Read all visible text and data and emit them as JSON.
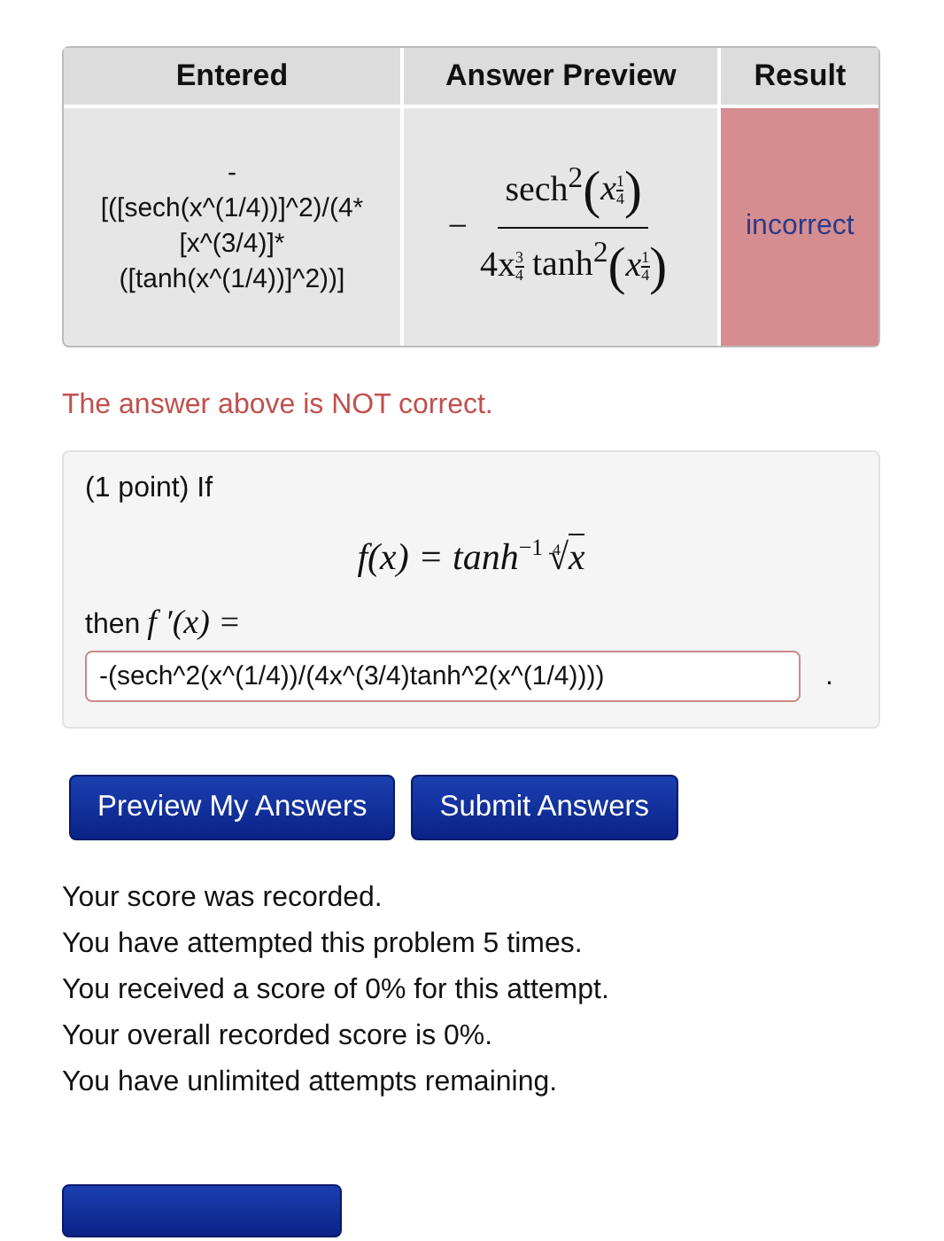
{
  "results_table": {
    "columns": [
      "Entered",
      "Answer Preview",
      "Result"
    ],
    "rows": [
      {
        "entered": "-\n[([sech(x^(1/4))]^2)/(4*\n[x^(3/4)]*\n([tanh(x^(1/4))]^2))]",
        "preview": {
          "sign": "−",
          "numerator": {
            "func": "sech",
            "power": "2",
            "open": "(",
            "base": "x",
            "exp_num": "1",
            "exp_den": "4",
            "close": ")"
          },
          "denominator": {
            "coef": "4x",
            "exp_num": "3",
            "exp_den": "4",
            "func": "tanh",
            "power": "2",
            "open": "(",
            "base": "x",
            "arg_exp_num": "1",
            "arg_exp_den": "4",
            "close": ")"
          }
        },
        "result": "incorrect",
        "correct": false
      }
    ]
  },
  "message": "The answer above is NOT correct.",
  "problem": {
    "intro": "(1 point) If",
    "formula": {
      "lhs": "f(x) = tanh",
      "sup": "−1",
      "root_index": "4",
      "radical": "√",
      "radicand": "x"
    },
    "then": "then",
    "derivative": "f ′(x) =",
    "answer": {
      "value": "-(sech^2(x^(1/4))/(4x^(3/4)tanh^2(x^(1/4))))"
    },
    "trailing": "."
  },
  "buttons": [
    "Preview My Answers",
    "Submit Answers"
  ],
  "score_lines": [
    "Your score was recorded.",
    "You have attempted this problem 5 times.",
    "You received a score of 0% for this attempt.",
    "Your overall recorded score is 0%.",
    "You have unlimited attempts remaining."
  ]
}
